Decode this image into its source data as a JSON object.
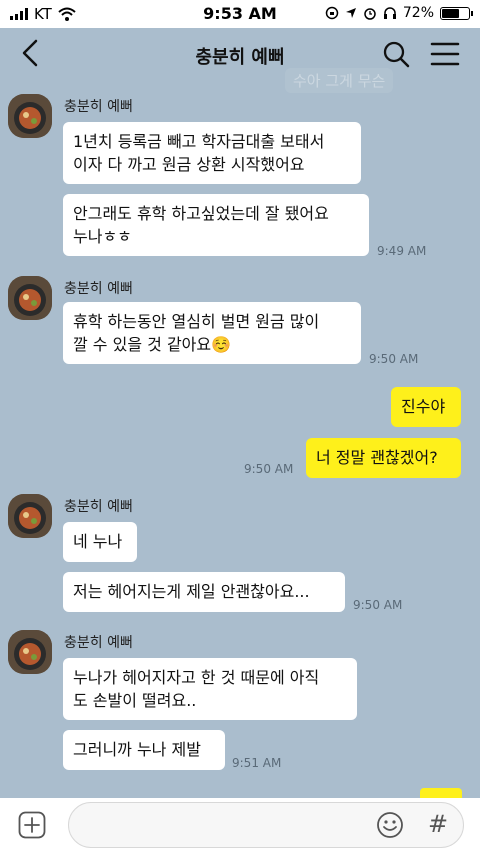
{
  "status": {
    "carrier": "KT",
    "time": "9:53 AM",
    "battery": "72%",
    "battery_level": 0.72
  },
  "header": {
    "title": "충분히 예뻐",
    "background_preview": "수아 그게 무슨"
  },
  "messages": [
    {
      "sender": "충분히 예뻐",
      "bubbles": [
        "1년치 등록금 빼고 학자금대출 보태서\n이자 다 까고 원금 상환 시작했어요",
        "안그래도 휴학 하고싶었는데 잘 됐어요\n누나ㅎㅎ"
      ],
      "time": "9:49 AM"
    },
    {
      "sender": "충분히 예뻐",
      "bubbles": [
        "휴학 하는동안 열심히 벌면 원금 많이\n깔 수 있을 것 같아요☺️"
      ],
      "time": "9:50 AM"
    },
    {
      "me_bubbles": [
        "진수야",
        "너 정말 괜찮겠어?"
      ],
      "time": "9:50 AM"
    },
    {
      "sender": "충분히 예뻐",
      "bubbles": [
        "네 누나",
        "저는 헤어지는게 제일 안괜찮아요..."
      ],
      "time": "9:50 AM"
    },
    {
      "sender": "충분히 예뻐",
      "bubbles": [
        "누나가 헤어지자고 한 것 때문에 아직\n도 손발이 떨려요..",
        "그러니까 누나 제발"
      ],
      "time": "9:51 AM"
    }
  ],
  "input": {
    "placeholder": ""
  },
  "colors": {
    "background": "#aabdcd",
    "my_bubble": "#fef01b",
    "their_bubble": "#ffffff"
  }
}
